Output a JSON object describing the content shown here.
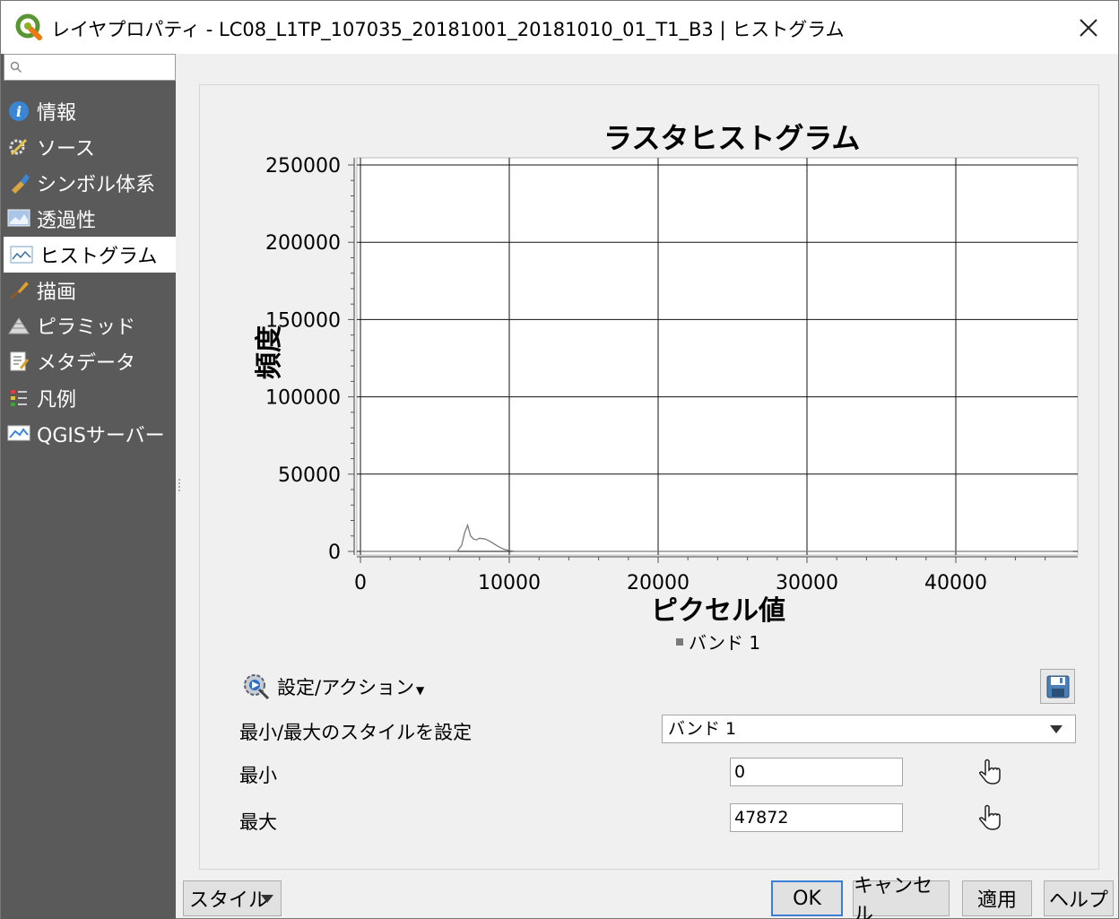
{
  "window": {
    "title": "レイヤプロパティ - LC08_L1TP_107035_20181001_20181010_01_T1_B3 | ヒストグラム"
  },
  "sidebar": {
    "search_placeholder": "",
    "items": [
      {
        "label": "情報",
        "icon": "info-icon"
      },
      {
        "label": "ソース",
        "icon": "source-icon"
      },
      {
        "label": "シンボル体系",
        "icon": "symbology-icon"
      },
      {
        "label": "透過性",
        "icon": "transparency-icon"
      },
      {
        "label": "ヒストグラム",
        "icon": "histogram-icon",
        "active": true
      },
      {
        "label": "描画",
        "icon": "rendering-icon"
      },
      {
        "label": "ピラミッド",
        "icon": "pyramid-icon"
      },
      {
        "label": "メタデータ",
        "icon": "metadata-icon"
      },
      {
        "label": "凡例",
        "icon": "legend-icon"
      },
      {
        "label": "QGISサーバー",
        "icon": "qgis-server-icon"
      }
    ]
  },
  "chart_data": {
    "type": "line",
    "title": "ラスタヒストグラム",
    "xlabel": "ピクセル値",
    "ylabel": "頻度",
    "xlim": [
      -500,
      48000
    ],
    "ylim": [
      0,
      250000
    ],
    "x_ticks": [
      0,
      10000,
      20000,
      30000,
      40000
    ],
    "y_ticks": [
      0,
      50000,
      100000,
      150000,
      200000,
      250000
    ],
    "x_tick_labels": [
      "0",
      "10000",
      "20000",
      "30000",
      "40000"
    ],
    "y_tick_labels": [
      "0",
      "50000",
      "100000",
      "150000",
      "200000",
      "250000"
    ],
    "grid": true,
    "legend_position": "bottom",
    "series": [
      {
        "name": "バンド 1",
        "color": "#7a7a7a",
        "x": [
          0,
          6500,
          6800,
          7000,
          7200,
          7400,
          7600,
          7800,
          8000,
          8400,
          8800,
          9200,
          9600,
          10000,
          10400,
          12000,
          20000,
          30000,
          40000,
          47872
        ],
        "y": [
          0,
          0,
          4000,
          12000,
          17000,
          10000,
          8000,
          7500,
          8500,
          8000,
          6000,
          3500,
          1500,
          500,
          0,
          0,
          0,
          0,
          0,
          0
        ]
      }
    ]
  },
  "actions": {
    "label": "設定/アクション"
  },
  "form": {
    "minmax_style_label": "最小/最大のスタイルを設定",
    "band_selected": "バンド 1",
    "min_label": "最小",
    "min_value": "0",
    "max_label": "最大",
    "max_value": "47872"
  },
  "buttons": {
    "style": "スタイル",
    "ok": "OK",
    "cancel": "キャンセル",
    "apply": "適用",
    "help": "ヘルプ"
  }
}
